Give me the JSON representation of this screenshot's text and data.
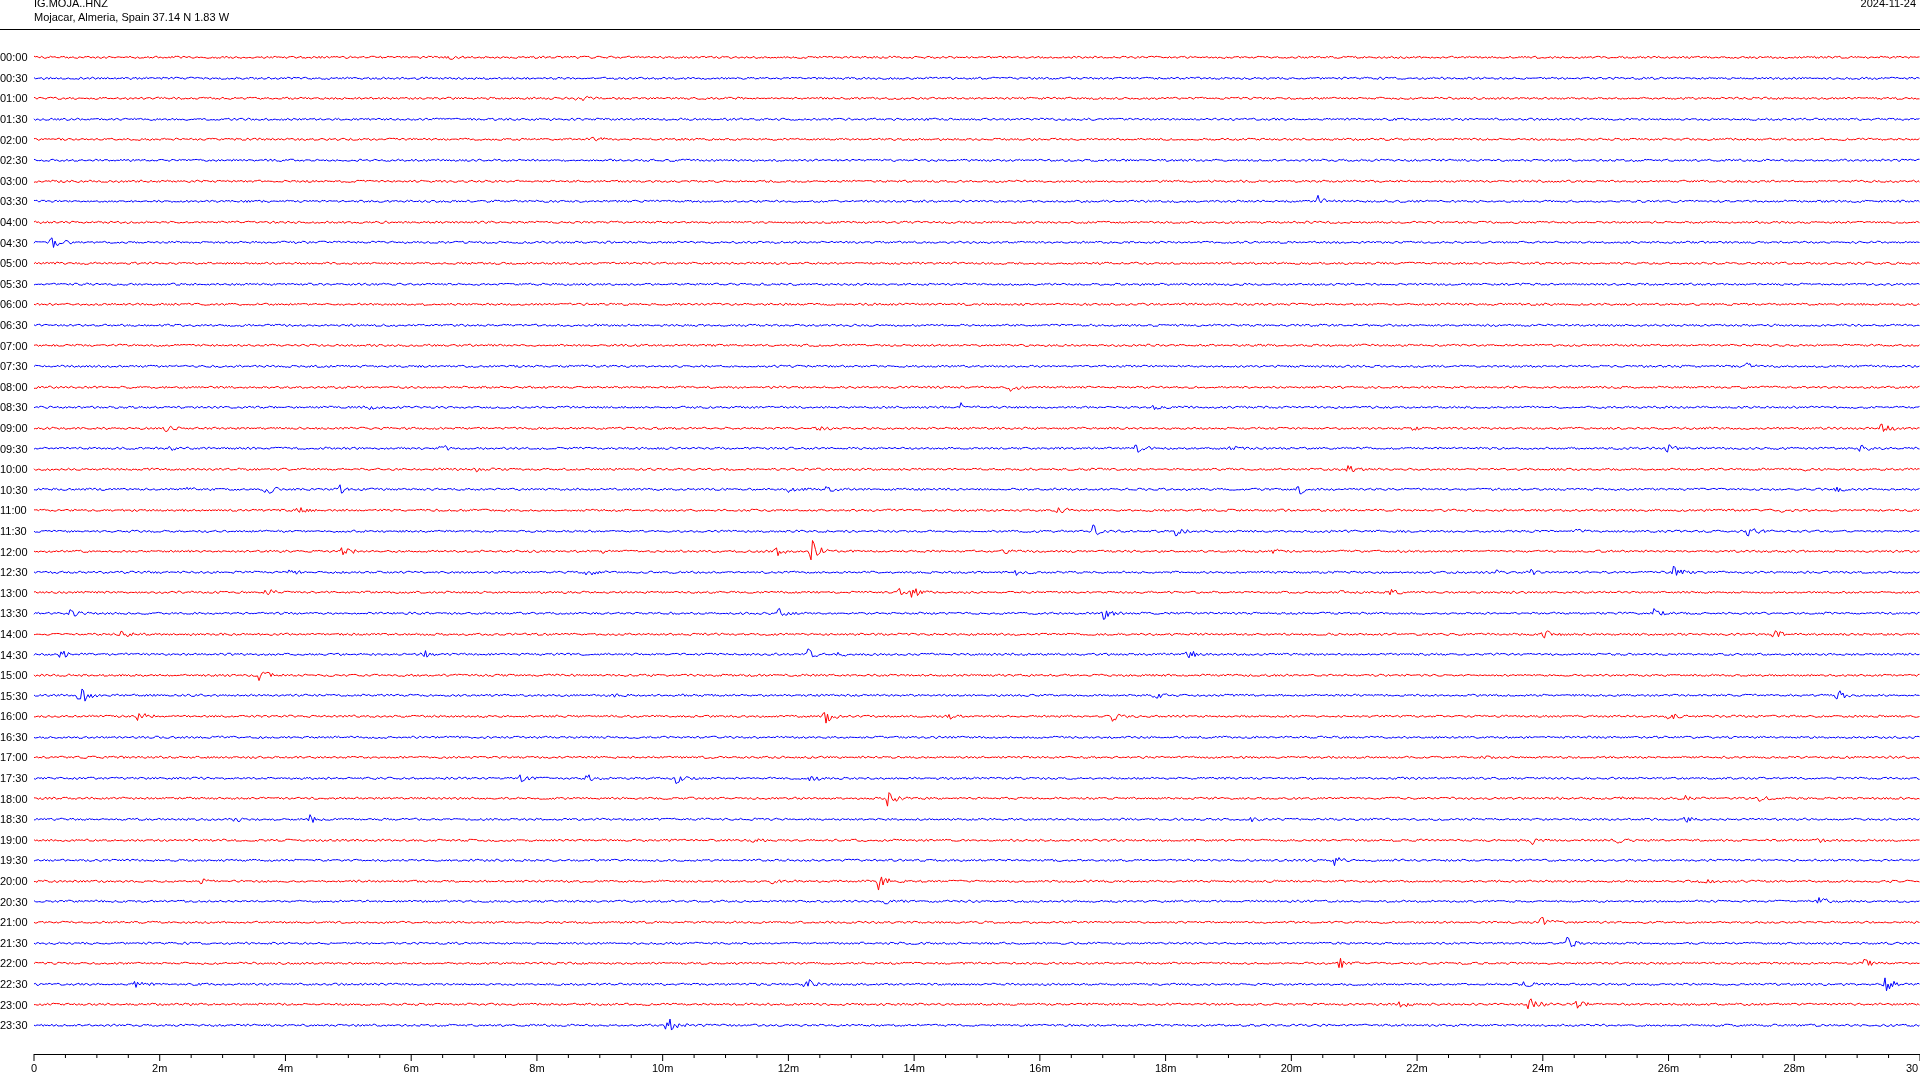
{
  "header": {
    "station": "IG.MOJA..HNZ",
    "location": "Mojacar, Almeria, Spain  37.14 N 1.83 W",
    "date": "2024-11-24"
  },
  "traces": [
    {
      "label": "00:00",
      "color": "#ff0000"
    },
    {
      "label": "00:30",
      "color": "#0000ff"
    },
    {
      "label": "01:00",
      "color": "#ff0000"
    },
    {
      "label": "01:30",
      "color": "#0000ff"
    },
    {
      "label": "02:00",
      "color": "#ff0000"
    },
    {
      "label": "02:30",
      "color": "#0000ff"
    },
    {
      "label": "03:00",
      "color": "#ff0000"
    },
    {
      "label": "03:30",
      "color": "#0000ff"
    },
    {
      "label": "04:00",
      "color": "#ff0000"
    },
    {
      "label": "04:30",
      "color": "#0000ff"
    },
    {
      "label": "05:00",
      "color": "#ff0000"
    },
    {
      "label": "05:30",
      "color": "#0000ff"
    },
    {
      "label": "06:00",
      "color": "#ff0000"
    },
    {
      "label": "06:30",
      "color": "#0000ff"
    },
    {
      "label": "07:00",
      "color": "#ff0000"
    },
    {
      "label": "07:30",
      "color": "#0000ff"
    },
    {
      "label": "08:00",
      "color": "#ff0000"
    },
    {
      "label": "08:30",
      "color": "#0000ff"
    },
    {
      "label": "09:00",
      "color": "#ff0000"
    },
    {
      "label": "09:30",
      "color": "#0000ff"
    },
    {
      "label": "10:00",
      "color": "#ff0000"
    },
    {
      "label": "10:30",
      "color": "#0000ff"
    },
    {
      "label": "11:00",
      "color": "#ff0000"
    },
    {
      "label": "11:30",
      "color": "#0000ff"
    },
    {
      "label": "12:00",
      "color": "#ff0000"
    },
    {
      "label": "12:30",
      "color": "#0000ff"
    },
    {
      "label": "13:00",
      "color": "#ff0000"
    },
    {
      "label": "13:30",
      "color": "#0000ff"
    },
    {
      "label": "14:00",
      "color": "#ff0000"
    },
    {
      "label": "14:30",
      "color": "#0000ff"
    },
    {
      "label": "15:00",
      "color": "#ff0000"
    },
    {
      "label": "15:30",
      "color": "#0000ff"
    },
    {
      "label": "16:00",
      "color": "#ff0000"
    },
    {
      "label": "16:30",
      "color": "#0000ff"
    },
    {
      "label": "17:00",
      "color": "#ff0000"
    },
    {
      "label": "17:30",
      "color": "#0000ff"
    },
    {
      "label": "18:00",
      "color": "#ff0000"
    },
    {
      "label": "18:30",
      "color": "#0000ff"
    },
    {
      "label": "19:00",
      "color": "#ff0000"
    },
    {
      "label": "19:30",
      "color": "#0000ff"
    },
    {
      "label": "20:00",
      "color": "#ff0000"
    },
    {
      "label": "20:30",
      "color": "#0000ff"
    },
    {
      "label": "21:00",
      "color": "#ff0000"
    },
    {
      "label": "21:30",
      "color": "#0000ff"
    },
    {
      "label": "22:00",
      "color": "#ff0000"
    },
    {
      "label": "22:30",
      "color": "#0000ff"
    },
    {
      "label": "23:00",
      "color": "#ff0000"
    },
    {
      "label": "23:30",
      "color": "#0000ff"
    }
  ],
  "x_axis": {
    "ticks": [
      "0",
      "2m",
      "4m",
      "6m",
      "8m",
      "10m",
      "12m",
      "14m",
      "16m",
      "18m",
      "20m",
      "22m",
      "24m",
      "26m",
      "28m",
      "30"
    ]
  }
}
